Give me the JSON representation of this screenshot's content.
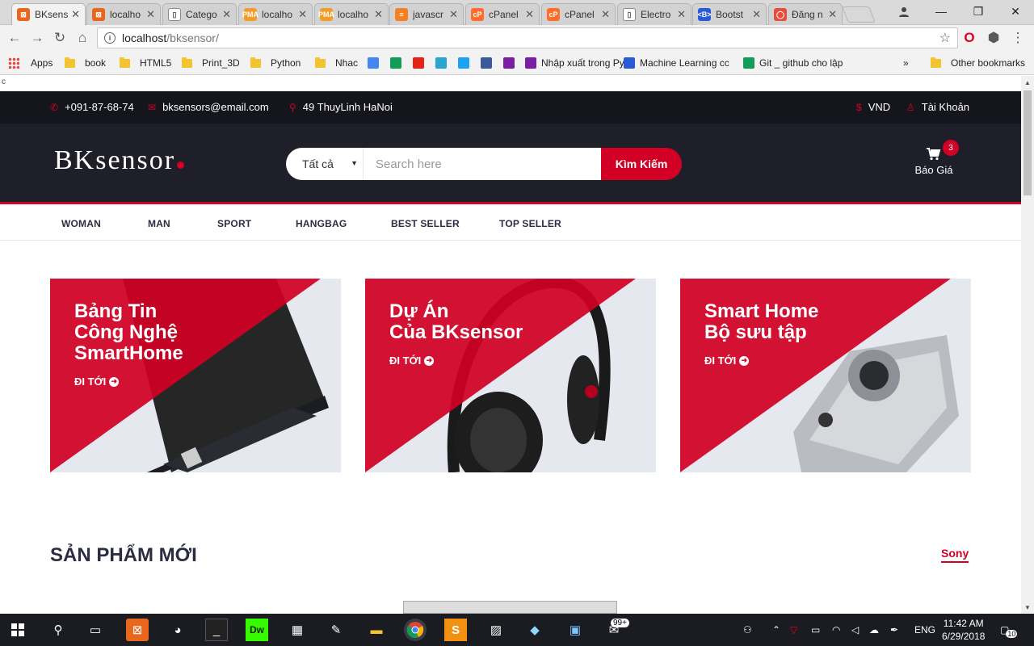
{
  "browser": {
    "tabs": [
      {
        "title": "BKsens",
        "fav_color": "#e8661d",
        "fav_glyph": "⊠",
        "active": true
      },
      {
        "title": "localho",
        "fav_color": "#e8661d",
        "fav_glyph": "⊠"
      },
      {
        "title": "Catego",
        "fav_color": "#ffffff",
        "fav_glyph": "▯"
      },
      {
        "title": "localho",
        "fav_color": "#f09d2a",
        "fav_glyph": "PMA"
      },
      {
        "title": "localho",
        "fav_color": "#f09d2a",
        "fav_glyph": "PMA"
      },
      {
        "title": "javascr",
        "fav_color": "#f48024",
        "fav_glyph": "≡"
      },
      {
        "title": "cPanel",
        "fav_color": "#ff6c2c",
        "fav_glyph": "cP"
      },
      {
        "title": "cPanel",
        "fav_color": "#ff6c2c",
        "fav_glyph": "cP"
      },
      {
        "title": "Electro",
        "fav_color": "#ffffff",
        "fav_glyph": "▯"
      },
      {
        "title": "Bootst",
        "fav_color": "#2a5bd7",
        "fav_glyph": "<B>"
      },
      {
        "title": "Đăng n",
        "fav_color": "#e84c3d",
        "fav_glyph": "◯"
      }
    ],
    "url_host": "localhost",
    "url_path": "/bksensor/",
    "bookmarks": [
      {
        "label": "Apps",
        "type": "apps"
      },
      {
        "label": "book",
        "type": "folder"
      },
      {
        "label": "HTML5",
        "type": "folder"
      },
      {
        "label": "Print_3D",
        "type": "folder"
      },
      {
        "label": "Python",
        "type": "folder"
      },
      {
        "label": "Nhac",
        "type": "folder"
      },
      {
        "label": "Nhập xuất trong Pytl",
        "type": "icon"
      },
      {
        "label": "Machine Learning cc",
        "type": "icon"
      },
      {
        "label": "Git _ github cho lập",
        "type": "icon"
      },
      {
        "label": "»",
        "type": "more"
      },
      {
        "label": "Other bookmarks",
        "type": "folder"
      }
    ]
  },
  "site": {
    "stray_char": "c",
    "phone": "+091-87-68-74",
    "email": "bksensors@email.com",
    "address": "49 ThuyLinh HaNoi",
    "currency": "VND",
    "account": "Tài Khoản",
    "logo": "BKsensor",
    "search_category": "Tất cả",
    "search_placeholder": "Search here",
    "search_button": "Kìm Kiếm",
    "cart_label": "Báo Giá",
    "cart_count": "3",
    "nav": [
      "WOMAN",
      "MAN",
      "SPORT",
      "HANGBAG",
      "BEST SELLER",
      "TOP SELLER"
    ],
    "banners": [
      {
        "title_lines": [
          "Bảng Tin",
          "Công Nghệ",
          "SmartHome"
        ],
        "cta": "ĐI TỚI"
      },
      {
        "title_lines": [
          "Dự Án",
          "Của BKsensor"
        ],
        "cta": "ĐI TỚI"
      },
      {
        "title_lines": [
          "Smart Home",
          "Bộ sưu tập"
        ],
        "cta": "ĐI TỚI"
      }
    ],
    "section_title": "SẢN PHẨM MỚI",
    "section_link": "Sony"
  },
  "taskbar": {
    "lang": "ENG",
    "time": "11:42 AM",
    "date": "6/29/2018",
    "notif_count": "10",
    "badge_count": "99+"
  },
  "colors": {
    "accent": "#d10024",
    "dark": "#1e1f29",
    "topbar": "#15161d"
  }
}
